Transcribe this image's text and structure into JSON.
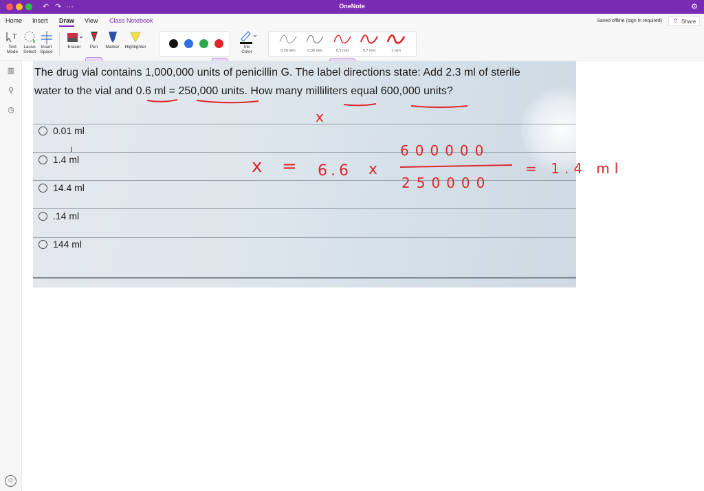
{
  "window": {
    "title": "OneNote",
    "undo_icon": "undo-icon",
    "redo_icon": "redo-icon",
    "more": "···"
  },
  "menu": {
    "tabs": [
      "Home",
      "Insert",
      "Draw",
      "View",
      "Class Notebook"
    ],
    "active_tab": "Draw",
    "status": "Saved offline (sign in required)",
    "share_label": "Share"
  },
  "ribbon": {
    "tools": {
      "text_mode": [
        "Text",
        "Mode"
      ],
      "lasso_select": [
        "Lasso",
        "Select"
      ],
      "insert_space": [
        "Insert",
        "Space"
      ],
      "eraser": "Eraser",
      "pen": "Pen",
      "marker": "Marker",
      "highlighter": "Highlighter",
      "ink_color": [
        "Ink",
        "Color"
      ]
    },
    "colors": [
      "#111111",
      "#2f6fe0",
      "#2fa84f",
      "#e0262a"
    ],
    "selected_color": "#e0262a",
    "stroke_sizes": [
      "0.25 mm",
      "0.35 mm",
      "0.5 mm",
      "0.7 mm",
      "1 mm"
    ],
    "selected_stroke": "0.5 mm"
  },
  "question": {
    "line1": "The drug vial contains 1,000,000 units of penicillin G. The label directions state: Add 2.3 ml of sterile",
    "line2": "water to the vial and 0.6 ml = 250,000 units. How many milliliters equal 600,000 units?",
    "options": [
      "0.01 ml",
      "1.4 ml",
      "14.4 ml",
      ".14 ml",
      "144 ml"
    ]
  },
  "handwriting": {
    "variable": "x",
    "lhs": "x",
    "equals": "=",
    "factor": "6.6",
    "times": "x",
    "numerator": "600000",
    "denominator": "250000",
    "result": "= 1.4 ml"
  },
  "accent_color": "#7a2bb3"
}
